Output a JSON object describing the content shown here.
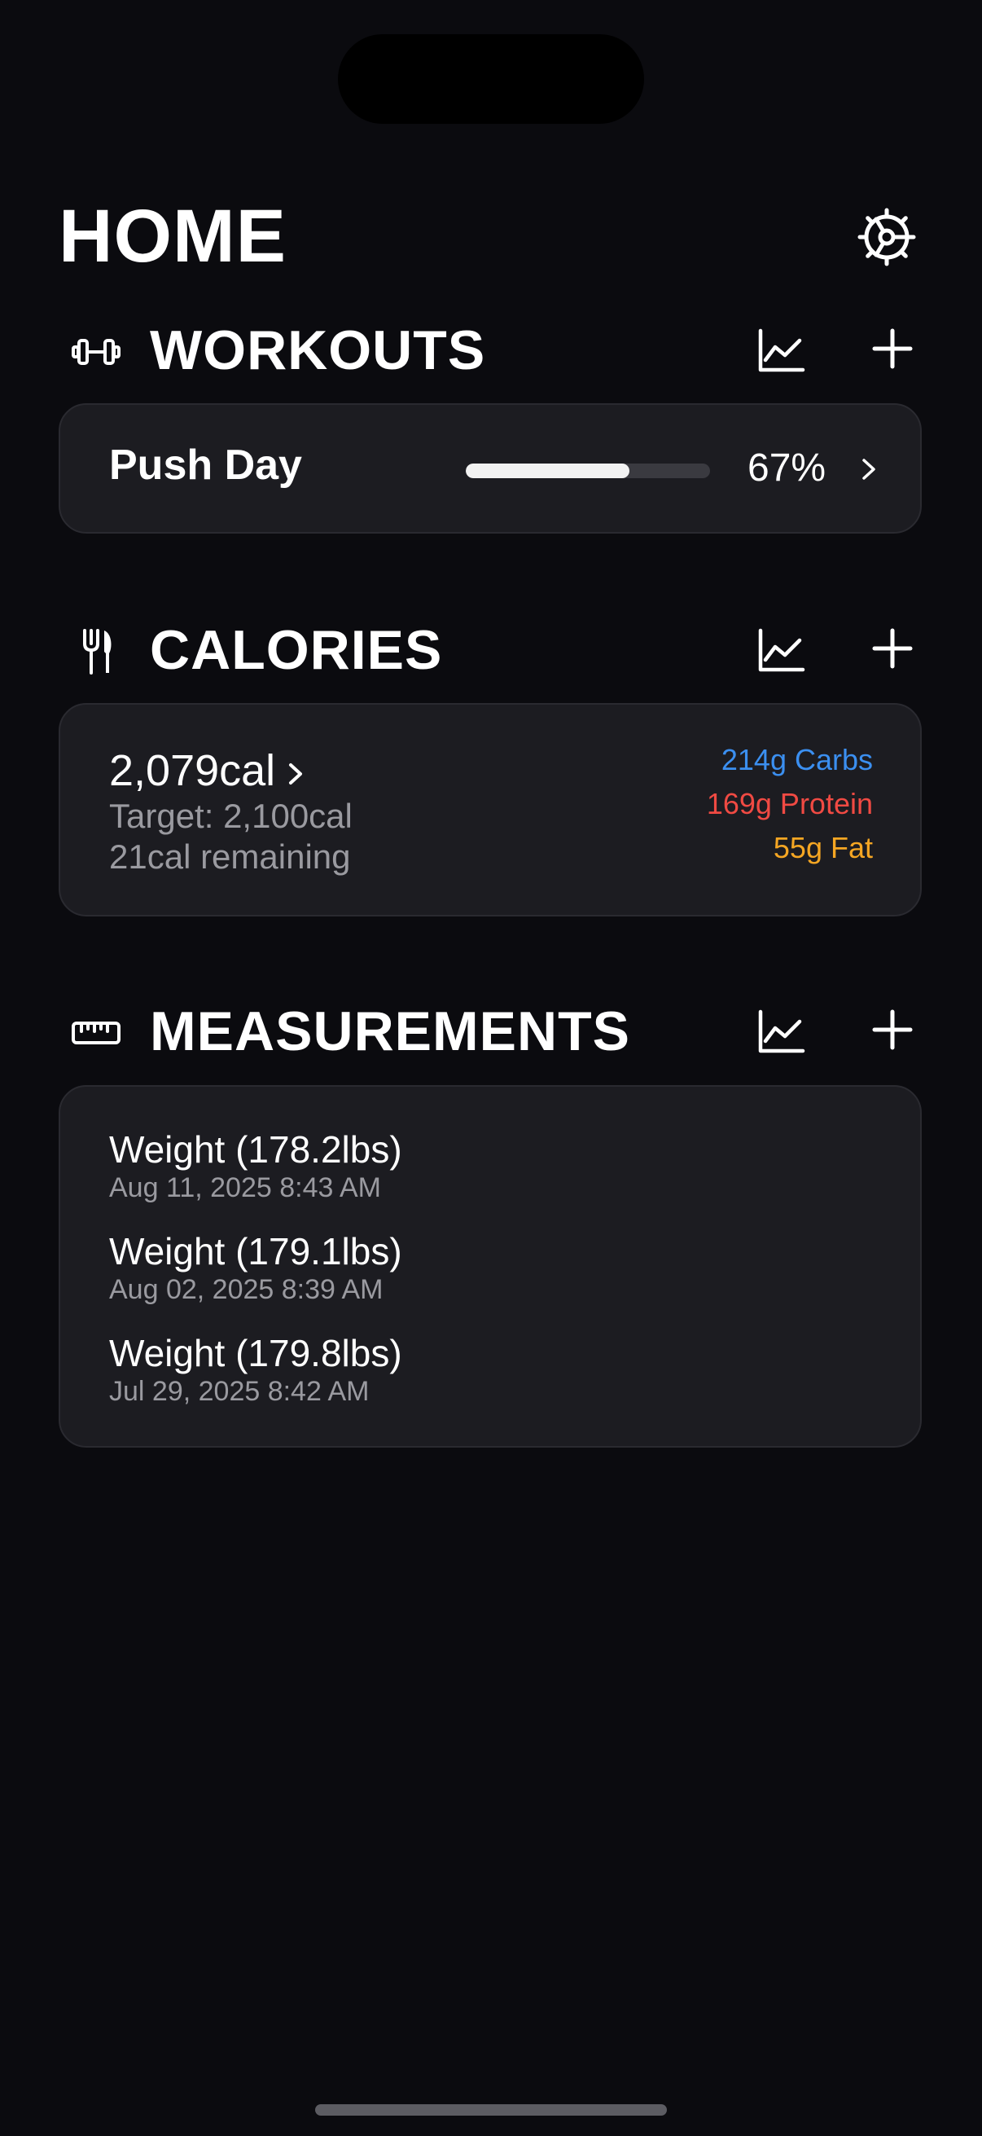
{
  "header": {
    "title": "HOME",
    "settings_icon": "gear-icon"
  },
  "workouts": {
    "title": "WORKOUTS",
    "icon": "dumbbell-icon",
    "item": {
      "name": "Push Day",
      "progress": 0.67,
      "progress_label": "67%"
    }
  },
  "calories": {
    "title": "CALORIES",
    "icon": "fork-knife-icon",
    "total": "2,079cal",
    "target": "Target: 2,100cal",
    "remaining": "21cal remaining",
    "macros": {
      "carbs": "214g Carbs",
      "protein": "169g Protein",
      "fat": "55g Fat"
    },
    "colors": {
      "carbs": "#3b8ff0",
      "protein": "#f04a43",
      "fat": "#f5a623"
    }
  },
  "measurements": {
    "title": "MEASUREMENTS",
    "icon": "ruler-icon",
    "entries": [
      {
        "name": "Weight (178.2lbs)",
        "date": "Aug 11, 2025 8:43 AM"
      },
      {
        "name": "Weight (179.1lbs)",
        "date": "Aug 02, 2025 8:39 AM"
      },
      {
        "name": "Weight (179.8lbs)",
        "date": "Jul 29, 2025 8:42 AM"
      }
    ]
  }
}
